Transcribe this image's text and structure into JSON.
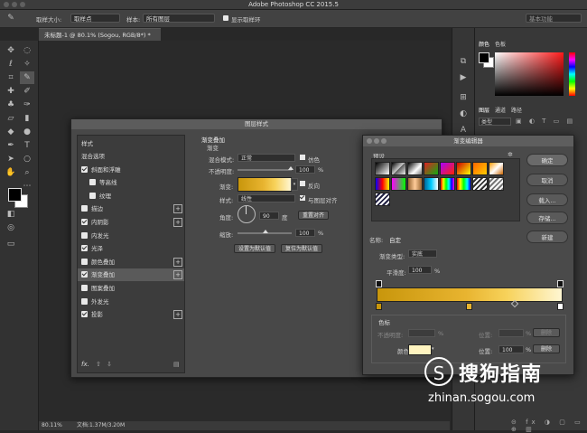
{
  "app": {
    "title": "Adobe Photoshop CC 2015.5"
  },
  "options_bar": {
    "sample_size_label": "取样大小:",
    "sample_size_value": "取样点",
    "sample_label": "样本:",
    "sample_value": "所有图层",
    "show_ring_label": "显示取样环",
    "workspace": "基本功能"
  },
  "document": {
    "tab_title": "未标题-1 @ 80.1% (Sogou, RGB/8*) *",
    "zoom": "80.11%",
    "doc_info": "文档:1.37M/3.20M"
  },
  "right_panel": {
    "tab_color": "颜色",
    "tab_swatches": "色板",
    "tab_layers": "图层",
    "tab_channels": "通道",
    "tab_paths": "路径",
    "kind": "类型"
  },
  "layer_style": {
    "title": "图层样式",
    "styles_header": "样式",
    "items": [
      {
        "label": "混合选项",
        "checkbox": false,
        "checked": false,
        "plus": false,
        "indent": false,
        "selected": false
      },
      {
        "label": "斜面和浮雕",
        "checkbox": true,
        "checked": true,
        "plus": false,
        "indent": false,
        "selected": false
      },
      {
        "label": "等高线",
        "checkbox": true,
        "checked": false,
        "plus": false,
        "indent": true,
        "selected": false
      },
      {
        "label": "纹理",
        "checkbox": true,
        "checked": false,
        "plus": false,
        "indent": true,
        "selected": false
      },
      {
        "label": "描边",
        "checkbox": true,
        "checked": false,
        "plus": true,
        "indent": false,
        "selected": false
      },
      {
        "label": "内阴影",
        "checkbox": true,
        "checked": true,
        "plus": true,
        "indent": false,
        "selected": false
      },
      {
        "label": "内发光",
        "checkbox": true,
        "checked": false,
        "plus": false,
        "indent": false,
        "selected": false
      },
      {
        "label": "光泽",
        "checkbox": true,
        "checked": true,
        "plus": false,
        "indent": false,
        "selected": false
      },
      {
        "label": "颜色叠加",
        "checkbox": true,
        "checked": false,
        "plus": true,
        "indent": false,
        "selected": false
      },
      {
        "label": "渐变叠加",
        "checkbox": true,
        "checked": true,
        "plus": true,
        "indent": false,
        "selected": true
      },
      {
        "label": "图案叠加",
        "checkbox": true,
        "checked": false,
        "plus": false,
        "indent": false,
        "selected": false
      },
      {
        "label": "外发光",
        "checkbox": true,
        "checked": false,
        "plus": false,
        "indent": false,
        "selected": false
      },
      {
        "label": "投影",
        "checkbox": true,
        "checked": true,
        "plus": true,
        "indent": false,
        "selected": false
      }
    ],
    "fx_label": "fx.",
    "section_title": "渐变叠加",
    "subsection": "渐变",
    "blend_mode_label": "混合模式:",
    "blend_mode_value": "正常",
    "dither_label": "仿色",
    "opacity_label": "不透明度:",
    "opacity_value": "100",
    "percent": "%",
    "gradient_label": "渐变:",
    "reverse_label": "反向",
    "style_label": "样式:",
    "style_value": "线性",
    "align_label": "与图层对齐",
    "angle_label": "角度:",
    "angle_value": "90",
    "degree": "度",
    "reset_align_btn": "重置对齐",
    "scale_label": "缩放:",
    "scale_value": "100",
    "set_default_btn": "设置为默认值",
    "reset_default_btn": "复位为默认值"
  },
  "gradient_editor": {
    "title": "渐变编辑器",
    "presets_label": "预设",
    "ok_btn": "确定",
    "cancel_btn": "取消",
    "load_btn": "载入...",
    "save_btn": "存储...",
    "name_label": "名称:",
    "name_value": "自定",
    "new_btn": "新建",
    "type_label": "渐变类型:",
    "type_value": "实底",
    "smooth_label": "平滑度:",
    "smooth_value": "100",
    "percent": "%",
    "stops_label": "色标",
    "opacity_label": "不透明度:",
    "position_label": "位置:",
    "delete_btn": "删除",
    "color_label": "颜色:",
    "position_value": "100",
    "gradient_colors": [
      "#c8960c",
      "#e8b430",
      "#f7d25a",
      "#fff6d2"
    ],
    "current_stop_color": "#fff4c0"
  },
  "watermark": {
    "text_cn": "搜狗指南",
    "text_url": "zhinan.sogou.com"
  }
}
